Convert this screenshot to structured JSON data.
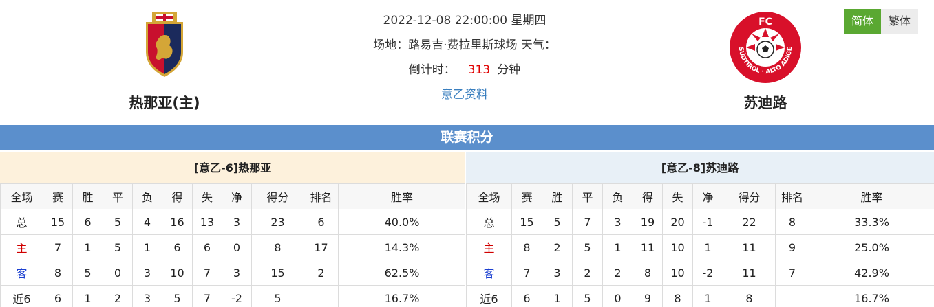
{
  "header": {
    "home_team": {
      "name": "热那亚(主)",
      "logo_icon": "genoa-crest-icon"
    },
    "away_team": {
      "name": "苏迪路",
      "logo_icon": "sudtirol-crest-icon",
      "logo_ring_text": "SÜDTIROL · ALTO ADIGE",
      "logo_top_text": "FC"
    },
    "datetime": "2022-12-08 22:00:00 星期四",
    "venue": "场地：路易吉·费拉里斯球场 天气：",
    "countdown_label": "倒计时：",
    "countdown_value": "313",
    "countdown_unit": "分钟",
    "league_link": "意乙资料"
  },
  "lang": {
    "simplified": "简体",
    "traditional": "繁体"
  },
  "banner": "联赛积分",
  "columns": [
    "全场",
    "赛",
    "胜",
    "平",
    "负",
    "得",
    "失",
    "净",
    "得分",
    "排名",
    "胜率"
  ],
  "home_table": {
    "title": "[意乙-6]热那亚",
    "rows": [
      [
        "总",
        "15",
        "6",
        "5",
        "4",
        "16",
        "13",
        "3",
        "23",
        "6",
        "40.0%"
      ],
      [
        "主",
        "7",
        "1",
        "5",
        "1",
        "6",
        "6",
        "0",
        "8",
        "17",
        "14.3%"
      ],
      [
        "客",
        "8",
        "5",
        "0",
        "3",
        "10",
        "7",
        "3",
        "15",
        "2",
        "62.5%"
      ],
      [
        "近6",
        "6",
        "1",
        "2",
        "3",
        "5",
        "7",
        "-2",
        "5",
        "",
        "16.7%"
      ]
    ]
  },
  "away_table": {
    "title": "[意乙-8]苏迪路",
    "rows": [
      [
        "总",
        "15",
        "5",
        "7",
        "3",
        "19",
        "20",
        "-1",
        "22",
        "8",
        "33.3%"
      ],
      [
        "主",
        "8",
        "2",
        "5",
        "1",
        "11",
        "10",
        "1",
        "11",
        "9",
        "25.0%"
      ],
      [
        "客",
        "7",
        "3",
        "2",
        "2",
        "8",
        "10",
        "-2",
        "11",
        "7",
        "42.9%"
      ],
      [
        "近6",
        "6",
        "1",
        "5",
        "0",
        "9",
        "8",
        "1",
        "8",
        "",
        "16.7%"
      ]
    ]
  },
  "colors": {
    "banner": "#5b8fcc",
    "countdown": "#e00000",
    "home_label": "#d00000",
    "away_label": "#1b3fd0",
    "active_lang": "#5aa832"
  }
}
